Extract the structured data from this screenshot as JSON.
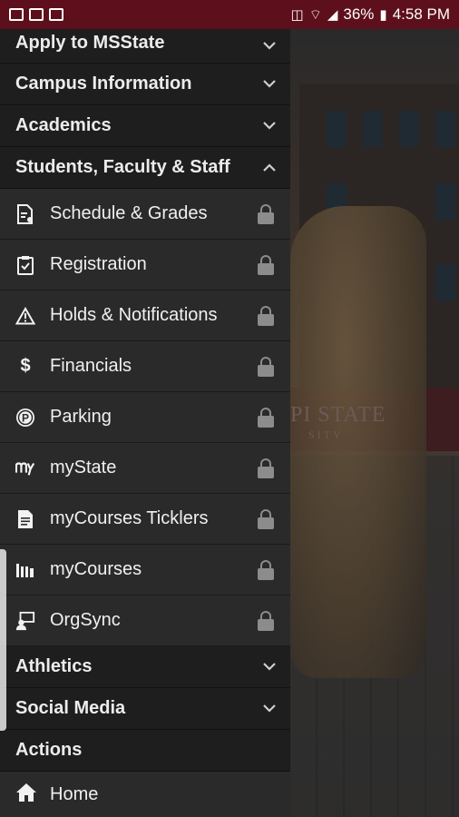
{
  "status_bar": {
    "battery": "36%",
    "time": "4:58 PM"
  },
  "background": {
    "banner_text": "PI STATE",
    "banner_sub": "SITY"
  },
  "menu": {
    "sections_top": [
      {
        "label": "Apply to MSState"
      },
      {
        "label": "Campus Information"
      },
      {
        "label": "Academics"
      },
      {
        "label": "Students, Faculty & Staff"
      }
    ],
    "subitems": [
      {
        "label": "Schedule & Grades",
        "icon": "schedule-grades-icon"
      },
      {
        "label": "Registration",
        "icon": "registration-clipboard-icon"
      },
      {
        "label": "Holds & Notifications",
        "icon": "warning-triangle-icon"
      },
      {
        "label": "Financials",
        "icon": "dollar-icon"
      },
      {
        "label": "Parking",
        "icon": "parking-icon"
      },
      {
        "label": "myState",
        "icon": "mystate-logo-icon"
      },
      {
        "label": "myCourses Ticklers",
        "icon": "document-icon"
      },
      {
        "label": "myCourses",
        "icon": "books-icon"
      },
      {
        "label": "OrgSync",
        "icon": "orgsync-icon"
      }
    ],
    "sections_bottom": [
      {
        "label": "Athletics"
      },
      {
        "label": "Social Media"
      },
      {
        "label": "Actions"
      }
    ],
    "home": {
      "label": "Home"
    }
  }
}
